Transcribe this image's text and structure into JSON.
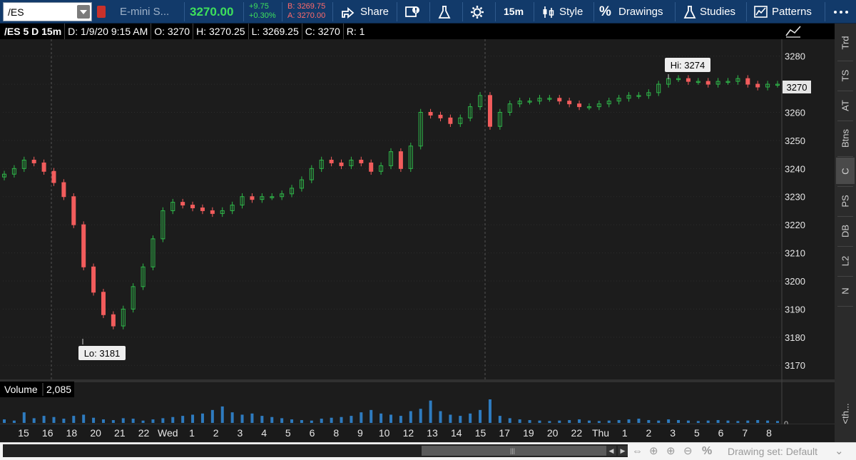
{
  "toolbar": {
    "symbol": "/ES",
    "description": "E-mini S...",
    "last_price": "3270.00",
    "net_change": "+9.75",
    "percent_change": "+0.30%",
    "bid": "B: 3269.75",
    "ask": "A: 3270.00",
    "share_label": "Share",
    "timeframe_label": "15m",
    "style_label": "Style",
    "drawings_label": "Drawings",
    "studies_label": "Studies",
    "patterns_label": "Patterns"
  },
  "header": {
    "symbol_period": "/ES 5 D 15m",
    "date_time": "D: 1/9/20 9:15 AM",
    "open": "O: 3270",
    "high": "H: 3270.25",
    "low": "L: 3269.25",
    "close": "C: 3270",
    "range": "R: 1"
  },
  "sidebar": {
    "tabs": [
      {
        "label": "Trd"
      },
      {
        "label": "TS"
      },
      {
        "label": "AT"
      },
      {
        "label": "Btns"
      },
      {
        "label": "C"
      },
      {
        "label": "PS"
      },
      {
        "label": "DB"
      },
      {
        "label": "L2"
      },
      {
        "label": "N"
      }
    ],
    "collapse_label": "<th..."
  },
  "volume": {
    "label": "Volume",
    "value": "2,085",
    "axis_zero": "0"
  },
  "bottom": {
    "drawing_set": "Drawing set: Default"
  },
  "colors": {
    "up": "#2fb84a",
    "down": "#f25c5c",
    "volume": "#2e7bbf",
    "toolbar": "#123a6a"
  },
  "chart_data": {
    "type": "candlestick",
    "y_ticks": [
      3280,
      3270,
      3260,
      3250,
      3240,
      3230,
      3220,
      3210,
      3200,
      3190,
      3180,
      3170
    ],
    "ylim": [
      3166,
      3286
    ],
    "current_price_label": "3270",
    "x_ticks": [
      "15",
      "16",
      "18",
      "20",
      "21",
      "22",
      "Wed",
      "1",
      "2",
      "3",
      "4",
      "5",
      "6",
      "8",
      "9",
      "10",
      "12",
      "13",
      "14",
      "15",
      "17",
      "19",
      "20",
      "22",
      "Thu",
      "1",
      "2",
      "3",
      "5",
      "6",
      "7",
      "8"
    ],
    "annotations": [
      {
        "text": "Hi: 3274",
        "value": 3274
      },
      {
        "text": "Lo: 3181",
        "value": 3181
      }
    ],
    "price_path": [
      3238,
      3240,
      3243,
      3242,
      3239,
      3235,
      3230,
      3220,
      3205,
      3196,
      3188,
      3184,
      3190,
      3198,
      3205,
      3215,
      3225,
      3228,
      3227,
      3226,
      3225,
      3224,
      3225,
      3227,
      3230,
      3229,
      3230,
      3230,
      3231,
      3233,
      3236,
      3240,
      3243,
      3242,
      3241,
      3243,
      3242,
      3239,
      3241,
      3246,
      3240,
      3248,
      3260,
      3259,
      3258,
      3256,
      3258,
      3262,
      3266,
      3255,
      3260,
      3263,
      3264,
      3264,
      3265,
      3265,
      3264,
      3263,
      3262,
      3262,
      3263,
      3264,
      3265,
      3266,
      3266,
      3267,
      3270,
      3272,
      3272,
      3271,
      3271,
      3270,
      3271,
      3271,
      3272,
      3270,
      3269,
      3270,
      3270
    ],
    "volume_levels": [
      0.15,
      0.1,
      0.45,
      0.2,
      0.3,
      0.25,
      0.18,
      0.3,
      0.35,
      0.22,
      0.15,
      0.12,
      0.2,
      0.18,
      0.1,
      0.15,
      0.2,
      0.25,
      0.3,
      0.35,
      0.4,
      0.55,
      0.7,
      0.45,
      0.35,
      0.4,
      0.3,
      0.25,
      0.2,
      0.15,
      0.12,
      0.1,
      0.18,
      0.22,
      0.25,
      0.3,
      0.45,
      0.55,
      0.4,
      0.35,
      0.3,
      0.5,
      0.6,
      0.95,
      0.5,
      0.35,
      0.3,
      0.4,
      0.55,
      1.0,
      0.3,
      0.2,
      0.15,
      0.12,
      0.1,
      0.08,
      0.1,
      0.12,
      0.15,
      0.1,
      0.08,
      0.1,
      0.12,
      0.15,
      0.18,
      0.12,
      0.1,
      0.15,
      0.12,
      0.1,
      0.08,
      0.1,
      0.12,
      0.1,
      0.08,
      0.1,
      0.12,
      0.1,
      0.08
    ]
  }
}
